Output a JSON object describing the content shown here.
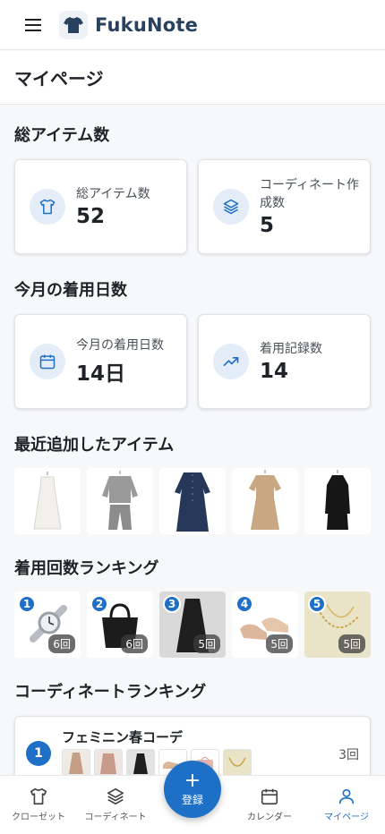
{
  "app": {
    "title": "FukuNote"
  },
  "page": {
    "title": "マイページ"
  },
  "sections": {
    "total_items": "総アイテム数",
    "wear_days": "今月の着用日数",
    "recent_items": "最近追加したアイテム",
    "wear_ranking": "着用回数ランキング",
    "coord_ranking": "コーディネートランキング"
  },
  "stats": {
    "total_items": {
      "label": "総アイテム数",
      "value": "52",
      "icon": "shirt-icon"
    },
    "coordinates": {
      "label": "コーディネート作成数",
      "value": "5",
      "icon": "layers-icon"
    },
    "wear_days": {
      "label": "今月の着用日数",
      "value": "14日",
      "icon": "calendar-icon"
    },
    "wear_records": {
      "label": "着用記録数",
      "value": "14",
      "icon": "trending-up-icon"
    }
  },
  "recent_items": [
    {
      "name": "white-sleeveless-dress"
    },
    {
      "name": "gray-sweat-setup"
    },
    {
      "name": "navy-shirt-dress"
    },
    {
      "name": "beige-tie-dress"
    },
    {
      "name": "black-long-dress"
    }
  ],
  "wear_ranking": [
    {
      "rank": "1",
      "count": "6回",
      "name": "silver-watch"
    },
    {
      "rank": "2",
      "count": "6回",
      "name": "black-tote-bag"
    },
    {
      "rank": "3",
      "count": "5回",
      "name": "black-skirt"
    },
    {
      "rank": "4",
      "count": "5回",
      "name": "beige-pumps"
    },
    {
      "rank": "5",
      "count": "5回",
      "name": "gold-necklace"
    }
  ],
  "coord_ranking": [
    {
      "rank": "1",
      "name": "フェミニン春コーデ",
      "count": "3回"
    }
  ],
  "nav": {
    "closet": "クローゼット",
    "coordinate": "コーディネート",
    "register": "登録",
    "calendar": "カレンダー",
    "mypage": "マイページ"
  },
  "colors": {
    "accent": "#1f6fc7",
    "brand": "#28425d",
    "icon_bg": "#e3ecf7"
  }
}
